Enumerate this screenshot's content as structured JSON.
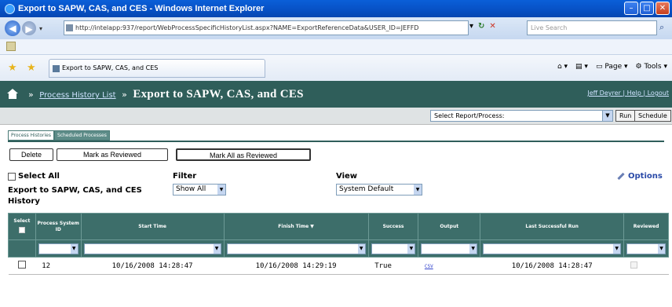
{
  "window": {
    "title": "Export to SAPW, CAS, and CES - Windows Internet Explorer",
    "minimize": "–",
    "maximize": "□",
    "close": "✕"
  },
  "browser": {
    "url": "http://intelapp:937/report/WebProcessSpecificHistoryList.aspx?NAME=ExportReferenceData&USER_ID=JEFFD",
    "search_placeholder": "Live Search",
    "tab_title": "Export to SAPW, CAS, and CES",
    "tools": {
      "page": "Page",
      "tools": "Tools"
    }
  },
  "app": {
    "breadcrumb_link": "Process History List",
    "breadcrumb_sep": "»",
    "page_title": "Export to SAPW, CAS, and CES",
    "user_links": "Jeff Deyrer | Help | Logout",
    "report_select": "Select Report/Process:",
    "run_button": "Run",
    "schedule_button": "Schedule"
  },
  "tabs": [
    {
      "label": "Process Histories",
      "active": true
    },
    {
      "label": "Scheduled Processes",
      "active": false
    }
  ],
  "actions": {
    "delete": "Delete",
    "mark_reviewed": "Mark as Reviewed",
    "mark_all_reviewed": "Mark All as Reviewed"
  },
  "filters": {
    "select_all": "Select All",
    "history_title": "Export to SAPW, CAS, and CES History",
    "filter_label": "Filter",
    "filter_value": "Show All",
    "view_label": "View",
    "view_value": "System Default",
    "options": "Options"
  },
  "grid": {
    "columns": [
      "Select",
      "Process System ID",
      "Start Time",
      "Finish Time",
      "Success",
      "Output",
      "Last Successful Run",
      "Reviewed"
    ],
    "rows": [
      {
        "process_system_id": "12",
        "start_time": "10/16/2008 14:28:47",
        "finish_time": "10/16/2008 14:29:19",
        "success": "True",
        "output": "CSV",
        "last_successful_run": "10/16/2008 14:28:47"
      }
    ]
  },
  "colors": {
    "header_teal": "#2f5e5a",
    "grid_header": "#3d6e6a",
    "ie_title_blue": "#0750c4"
  }
}
